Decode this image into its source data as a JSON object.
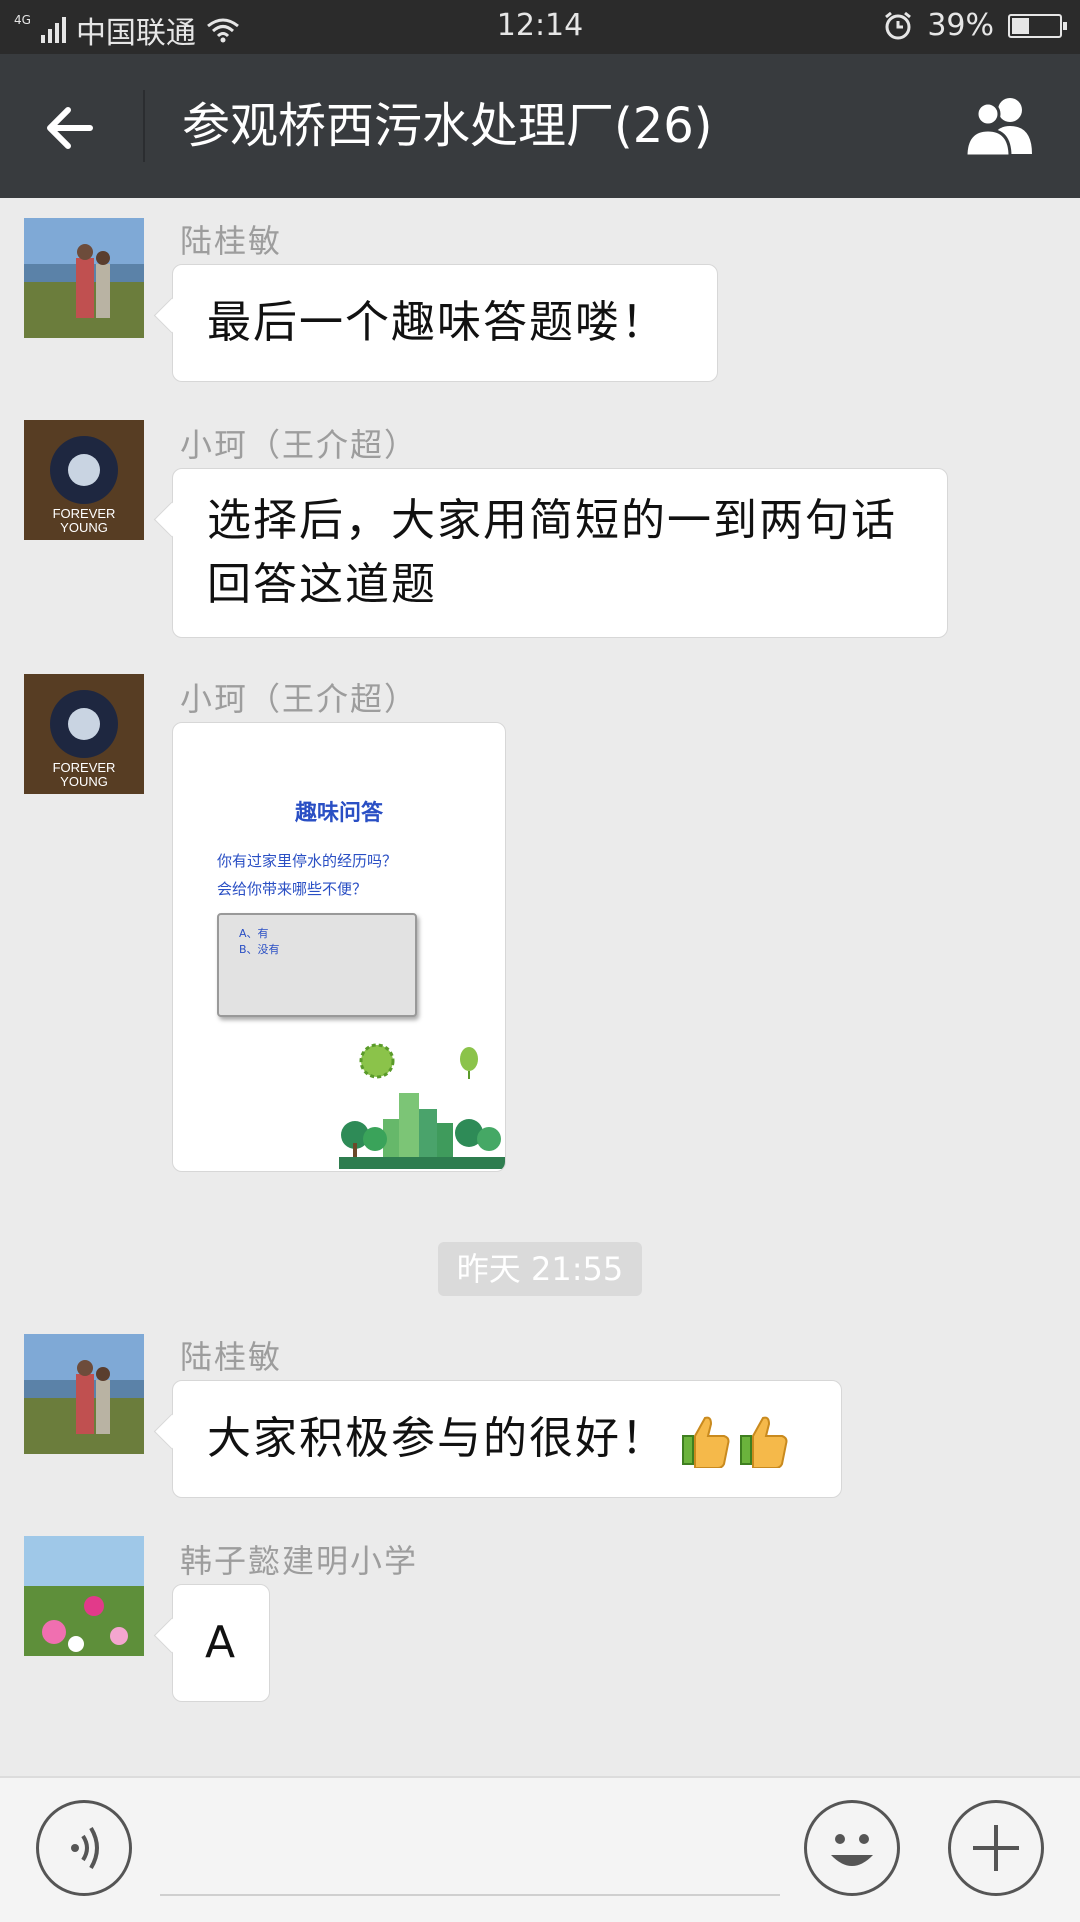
{
  "status": {
    "network_type": "4G",
    "carrier": "中国联通",
    "time": "12:14",
    "battery": "39%"
  },
  "header": {
    "title": "参观桥西污水处理厂(26)"
  },
  "messages": [
    {
      "sender": "陆桂敏",
      "text": "最后一个趣味答题喽！"
    },
    {
      "sender": "小珂（王介超）",
      "lines": [
        "选择后，大家用简短的一到两句话",
        "回答这道题"
      ]
    },
    {
      "sender": "小珂（王介超）",
      "image": {
        "title": "趣味问答",
        "question_lines": [
          "你有过家里停水的经历吗？",
          "会给你带来哪些不便？"
        ],
        "options": [
          "A、有",
          "B、没有"
        ]
      }
    },
    {
      "sender": "陆桂敏",
      "text": "大家积极参与的很好！"
    },
    {
      "sender": "韩子懿建明小学",
      "text": "A"
    }
  ],
  "timestamp": "昨天 21:55",
  "avatars": {
    "a1": "FOREVER",
    "a2": "YOUNG"
  },
  "colors": {
    "header_bg": "#383b3e",
    "chat_bg": "#ebebeb",
    "quiz_blue": "#2a4fc4"
  }
}
